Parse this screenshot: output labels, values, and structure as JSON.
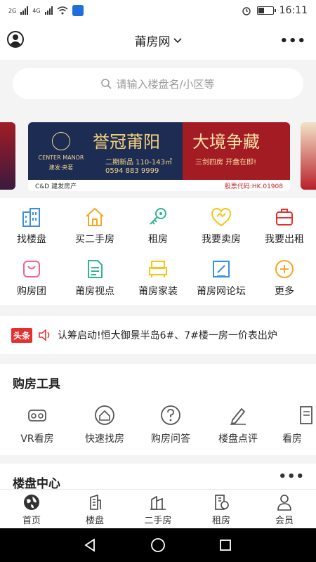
{
  "status_bar": {
    "signal1": "2G",
    "signal2": "4G",
    "time": "16:11",
    "battery_level": 0.45
  },
  "header": {
    "title": "莆房网",
    "more": "•••"
  },
  "search": {
    "placeholder": "请输入楼盘名/小区等"
  },
  "banner": {
    "brand_line1": "CENTER MANOR",
    "brand_line2": "建发·央著",
    "slogan_left": "誉冠莆阳",
    "sub_left": "二期新品 110-143㎡",
    "phone": "0594 883 9999",
    "slogan_right": "大境争藏",
    "sub_right": "三剑四房 开盘在即!",
    "footer_brand": "C&D 建发房产",
    "footer_code": "股票代码:HK.01908"
  },
  "quick_grid": [
    {
      "label": "找楼盘",
      "icon": "building-icon"
    },
    {
      "label": "买二手房",
      "icon": "house-icon"
    },
    {
      "label": "租房",
      "icon": "key-icon"
    },
    {
      "label": "我要卖房",
      "icon": "handshake-icon"
    },
    {
      "label": "我要出租",
      "icon": "suitcase-icon"
    },
    {
      "label": "购房团",
      "icon": "bag-icon"
    },
    {
      "label": "莆房视点",
      "icon": "document-icon"
    },
    {
      "label": "莆房家装",
      "icon": "sofa-icon"
    },
    {
      "label": "莆房网论坛",
      "icon": "edit-icon"
    },
    {
      "label": "更多",
      "icon": "plus-circle-icon"
    }
  ],
  "news": {
    "tag": "头条",
    "text": "认筹启动!恒大御景半岛6#、7#楼一房一价表出炉"
  },
  "tools": {
    "title": "购房工具",
    "items": [
      {
        "label": "VR看房",
        "icon": "vr-icon"
      },
      {
        "label": "快速找房",
        "icon": "home-search-icon"
      },
      {
        "label": "购房问答",
        "icon": "question-icon"
      },
      {
        "label": "楼盘点评",
        "icon": "pen-icon"
      },
      {
        "label": "看房",
        "icon": "notebook-icon"
      }
    ]
  },
  "center": {
    "title": "楼盘中心",
    "more": "•••"
  },
  "tabbar": [
    {
      "label": "首页",
      "icon": "globe-icon"
    },
    {
      "label": "楼盘",
      "icon": "tower-icon"
    },
    {
      "label": "二手房",
      "icon": "buildings-icon"
    },
    {
      "label": "租房",
      "icon": "rent-icon"
    },
    {
      "label": "会员",
      "icon": "user-icon"
    }
  ],
  "colors": {
    "accent_red": "#e5312d",
    "blue": "#3b8fe0",
    "orange": "#f5a623",
    "green": "#2fb58f"
  }
}
